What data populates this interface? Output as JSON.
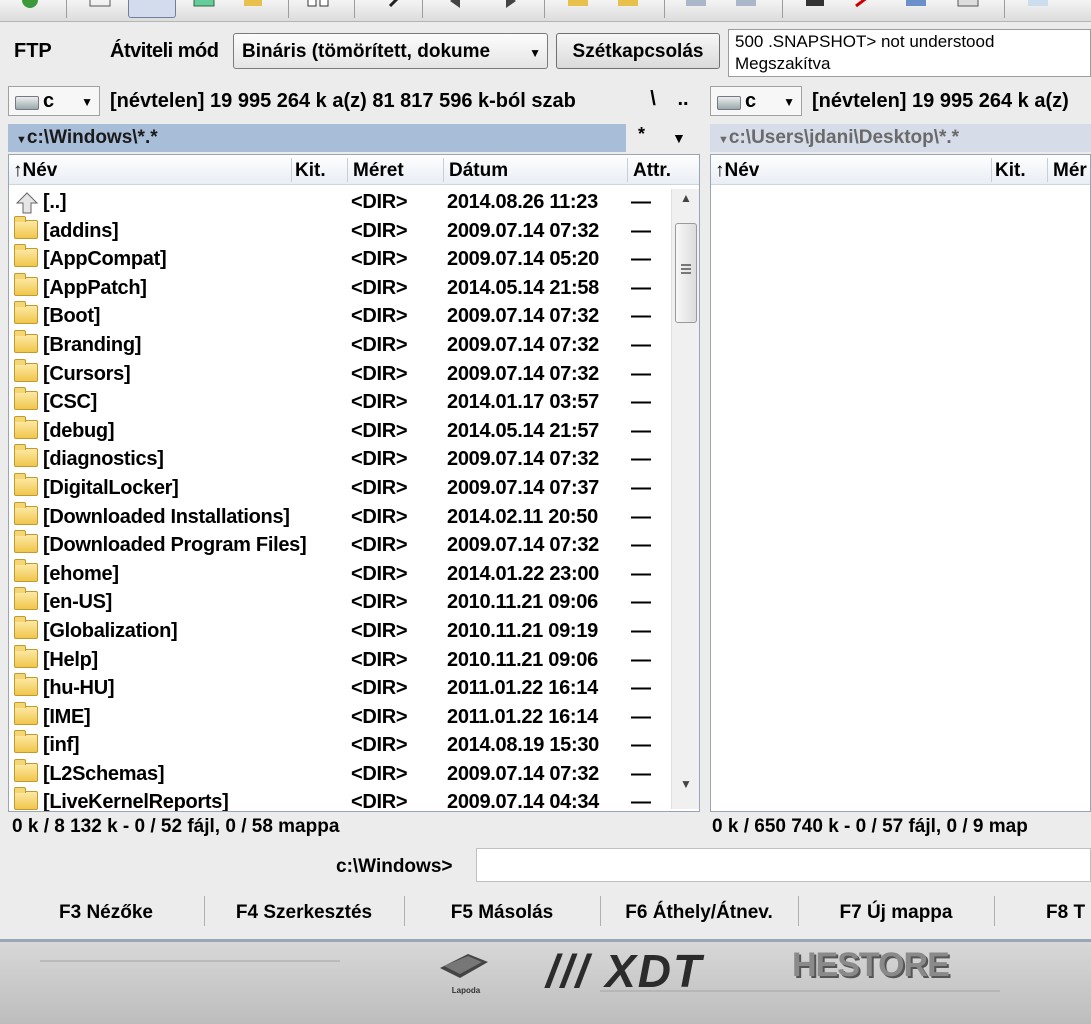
{
  "ftp": {
    "label": "FTP",
    "transfer_mode_label": "Átviteli mód",
    "transfer_mode_value": "Bináris (tömörített, dokume",
    "disconnect_label": "Szétkapcsolás",
    "log_lines": [
      "500 .SNAPSHOT> not understood",
      "Megszakítva"
    ]
  },
  "left": {
    "drive": "c",
    "drive_info": "[névtelen]  19 995 264 k a(z) 81 817 596 k-ból szab",
    "nav_root": "\\",
    "nav_up": "..",
    "path": "c:\\Windows\\*.*",
    "star": "*",
    "columns": {
      "name": "Név",
      "ext": "Kit.",
      "size": "Méret",
      "date": "Dátum",
      "attr": "Attr."
    },
    "rows": [
      {
        "name": "[..]",
        "size": "<DIR>",
        "date": "2014.08.26 11:23",
        "attr": "—",
        "up": true
      },
      {
        "name": "[addins]",
        "size": "<DIR>",
        "date": "2009.07.14 07:32",
        "attr": "—"
      },
      {
        "name": "[AppCompat]",
        "size": "<DIR>",
        "date": "2009.07.14 05:20",
        "attr": "—"
      },
      {
        "name": "[AppPatch]",
        "size": "<DIR>",
        "date": "2014.05.14 21:58",
        "attr": "—"
      },
      {
        "name": "[Boot]",
        "size": "<DIR>",
        "date": "2009.07.14 07:32",
        "attr": "—"
      },
      {
        "name": "[Branding]",
        "size": "<DIR>",
        "date": "2009.07.14 07:32",
        "attr": "—"
      },
      {
        "name": "[Cursors]",
        "size": "<DIR>",
        "date": "2009.07.14 07:32",
        "attr": "—"
      },
      {
        "name": "[CSC]",
        "size": "<DIR>",
        "date": "2014.01.17 03:57",
        "attr": "—"
      },
      {
        "name": "[debug]",
        "size": "<DIR>",
        "date": "2014.05.14 21:57",
        "attr": "—"
      },
      {
        "name": "[diagnostics]",
        "size": "<DIR>",
        "date": "2009.07.14 07:32",
        "attr": "—"
      },
      {
        "name": "[DigitalLocker]",
        "size": "<DIR>",
        "date": "2009.07.14 07:37",
        "attr": "—"
      },
      {
        "name": "[Downloaded Installations]",
        "size": "<DIR>",
        "date": "2014.02.11 20:50",
        "attr": "—"
      },
      {
        "name": "[Downloaded Program Files]",
        "size": "<DIR>",
        "date": "2009.07.14 07:32",
        "attr": "—"
      },
      {
        "name": "[ehome]",
        "size": "<DIR>",
        "date": "2014.01.22 23:00",
        "attr": "—"
      },
      {
        "name": "[en-US]",
        "size": "<DIR>",
        "date": "2010.11.21 09:06",
        "attr": "—"
      },
      {
        "name": "[Globalization]",
        "size": "<DIR>",
        "date": "2010.11.21 09:19",
        "attr": "—"
      },
      {
        "name": "[Help]",
        "size": "<DIR>",
        "date": "2010.11.21 09:06",
        "attr": "—"
      },
      {
        "name": "[hu-HU]",
        "size": "<DIR>",
        "date": "2011.01.22 16:14",
        "attr": "—"
      },
      {
        "name": "[IME]",
        "size": "<DIR>",
        "date": "2011.01.22 16:14",
        "attr": "—"
      },
      {
        "name": "[inf]",
        "size": "<DIR>",
        "date": "2014.08.19 15:30",
        "attr": "—"
      },
      {
        "name": "[L2Schemas]",
        "size": "<DIR>",
        "date": "2009.07.14 07:32",
        "attr": "—"
      },
      {
        "name": "[LiveKernelReports]",
        "size": "<DIR>",
        "date": "2009.07.14 04:34",
        "attr": "—"
      }
    ],
    "status": "0 k / 8 132 k - 0 / 52 fájl, 0 / 58 mappa"
  },
  "right": {
    "drive": "c",
    "drive_info": "[névtelen]  19 995 264 k a(z)",
    "path": "c:\\Users\\jdani\\Desktop\\*.*",
    "columns": {
      "name": "Név",
      "ext": "Kit.",
      "size": "Mér"
    },
    "status": "0 k / 650 740 k - 0 / 57 fájl, 0 / 9 map"
  },
  "command_line": {
    "prompt": "c:\\Windows>"
  },
  "function_keys": [
    "F3 Nézőke",
    "F4 Szerkesztés",
    "F5 Másolás",
    "F6 Áthely/Átnev.",
    "F7 Új mappa",
    "F8 T"
  ],
  "desktop_logos": {
    "lapoda": "Lapoda",
    "xdt": "/// XDT",
    "hestore": "HESTORE"
  },
  "colors": {
    "active_path": "#a8bdd8",
    "inactive_path": "#d6dde8",
    "folder": "#f0c64c"
  }
}
